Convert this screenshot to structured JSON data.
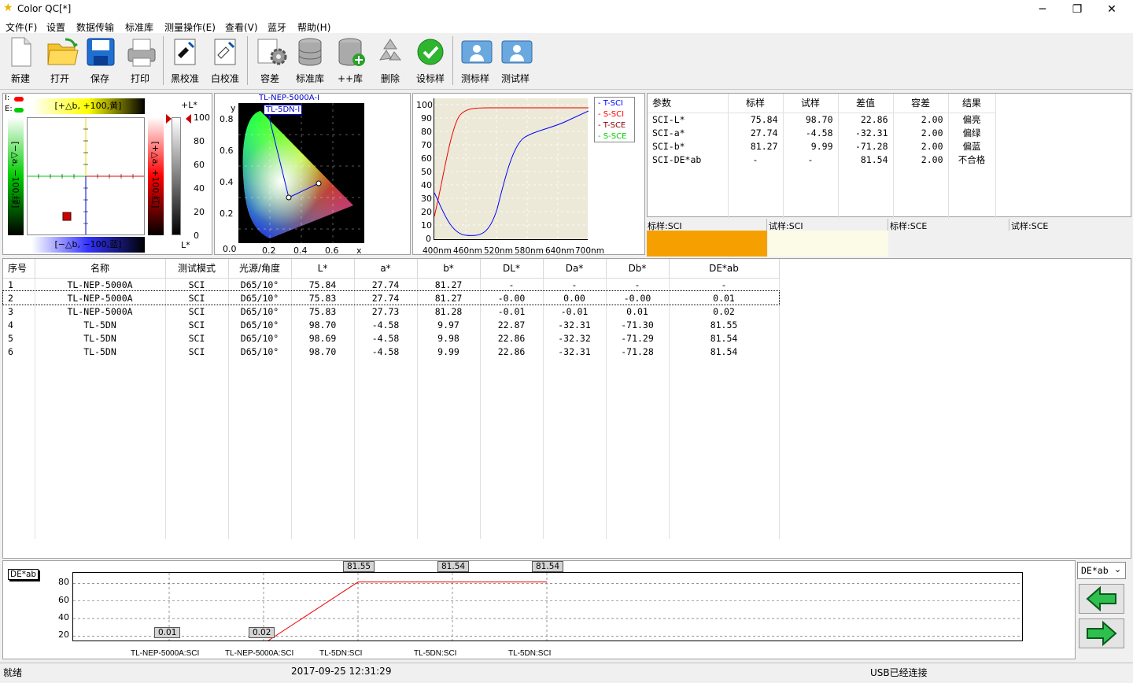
{
  "window": {
    "title": "Color QC[*]",
    "minimize": "─",
    "maximize": "❐",
    "close": "✕"
  },
  "menu": [
    "文件(F)",
    "设置",
    "数据传输",
    "标准库",
    "测量操作(E)",
    "查看(V)",
    "蓝牙",
    "帮助(H)"
  ],
  "toolbar": [
    "新建",
    "打开",
    "保存",
    "打印",
    "黑校准",
    "白校准",
    "容差",
    "标准库",
    "++库",
    "删除",
    "设标样",
    "测标样",
    "测试样"
  ],
  "lab_panel": {
    "i_label": "I:",
    "e_label": "E:",
    "pos_b": "[+△b, +100,黄]",
    "neg_b": "[−△b, −100,蓝]",
    "neg_a": "[−△a, −100,绿]",
    "pos_a": "[+△a, +100,红]",
    "l_plus": "+L*",
    "l_minus": "L*",
    "l_ticks": [
      "100",
      "80",
      "60",
      "40",
      "20",
      "0"
    ]
  },
  "cie_panel": {
    "ylabel": "y",
    "xlabel": "x",
    "yticks": [
      "0.8",
      "0.6",
      "0.4",
      "0.2"
    ],
    "xticks": [
      "0.0",
      "0.2",
      "0.4",
      "0.6"
    ],
    "label1": "TL-NEP-5000A-I",
    "label2": "TL-5DN-I"
  },
  "spectrum_panel": {
    "yticks": [
      "100",
      "90",
      "80",
      "70",
      "60",
      "50",
      "40",
      "30",
      "20",
      "10",
      "0"
    ],
    "xticks": [
      "400nm",
      "460nm",
      "520nm",
      "580nm",
      "640nm",
      "700nm"
    ],
    "legend": [
      "T-SCI",
      "S-SCI",
      "T-SCE",
      "S-SCE"
    ],
    "legend_colors": [
      "#0000ff",
      "#ff0000",
      "#800000",
      "#00ff00"
    ]
  },
  "results": {
    "headers": [
      "参数",
      "标样",
      "试样",
      "差值",
      "容差",
      "结果"
    ],
    "rows": [
      [
        "SCI-L*",
        "75.84",
        "98.70",
        "22.86",
        "2.00",
        "偏亮"
      ],
      [
        "SCI-a*",
        "27.74",
        "-4.58",
        "-32.31",
        "2.00",
        "偏绿"
      ],
      [
        "SCI-b*",
        "81.27",
        "9.99",
        "-71.28",
        "2.00",
        "偏蓝"
      ],
      [
        "SCI-DE*ab",
        "-",
        "-",
        "81.54",
        "2.00",
        "不合格"
      ]
    ]
  },
  "swatches": [
    {
      "label": "标样:SCI",
      "color": "#f5a000"
    },
    {
      "label": "试样:SCI",
      "color": "#fbfbe8"
    },
    {
      "label": "标样:SCE",
      "color": "#f0f0f0"
    },
    {
      "label": "试样:SCE",
      "color": "#f0f0f0"
    }
  ],
  "data_table": {
    "headers": [
      "序号",
      "名称",
      "测试模式",
      "光源/角度",
      "L*",
      "a*",
      "b*",
      "DL*",
      "Da*",
      "Db*",
      "DE*ab"
    ],
    "rows": [
      [
        "1",
        "TL-NEP-5000A",
        "SCI",
        "D65/10°",
        "75.84",
        "27.74",
        "81.27",
        "-",
        "-",
        "-",
        "-"
      ],
      [
        "2",
        "TL-NEP-5000A",
        "SCI",
        "D65/10°",
        "75.83",
        "27.74",
        "81.27",
        "-0.00",
        "0.00",
        "-0.00",
        "0.01"
      ],
      [
        "3",
        "TL-NEP-5000A",
        "SCI",
        "D65/10°",
        "75.83",
        "27.73",
        "81.28",
        "-0.01",
        "-0.01",
        "0.01",
        "0.02"
      ],
      [
        "4",
        "TL-5DN",
        "SCI",
        "D65/10°",
        "98.70",
        "-4.58",
        "9.97",
        "22.87",
        "-32.31",
        "-71.30",
        "81.55"
      ],
      [
        "5",
        "TL-5DN",
        "SCI",
        "D65/10°",
        "98.69",
        "-4.58",
        "9.98",
        "22.86",
        "-32.32",
        "-71.29",
        "81.54"
      ],
      [
        "6",
        "TL-5DN",
        "SCI",
        "D65/10°",
        "98.70",
        "-4.58",
        "9.99",
        "22.86",
        "-32.31",
        "-71.28",
        "81.54"
      ]
    ]
  },
  "trend": {
    "tag": "DE*ab",
    "dropdown": "DE*ab",
    "yticks": [
      "80",
      "60",
      "40",
      "20"
    ],
    "xlabels": [
      "TL-NEP-5000A:SCI",
      "TL-NEP-5000A:SCI",
      "TL-5DN:SCI",
      "TL-5DN:SCI",
      "TL-5DN:SCI"
    ]
  },
  "chart_data": [
    {
      "type": "line",
      "title": "",
      "xlabel": "",
      "ylabel": "",
      "categories": [
        "TL-NEP-5000A:SCI",
        "TL-NEP-5000A:SCI",
        "TL-5DN:SCI",
        "TL-5DN:SCI",
        "TL-5DN:SCI"
      ],
      "values": [
        0.01,
        0.02,
        81.55,
        81.54,
        81.54
      ],
      "ylim": [
        15,
        92
      ],
      "grid": true
    }
  ],
  "status": {
    "left": "就绪",
    "time": "2017-09-25 12:31:29",
    "usb": "USB已经连接"
  }
}
